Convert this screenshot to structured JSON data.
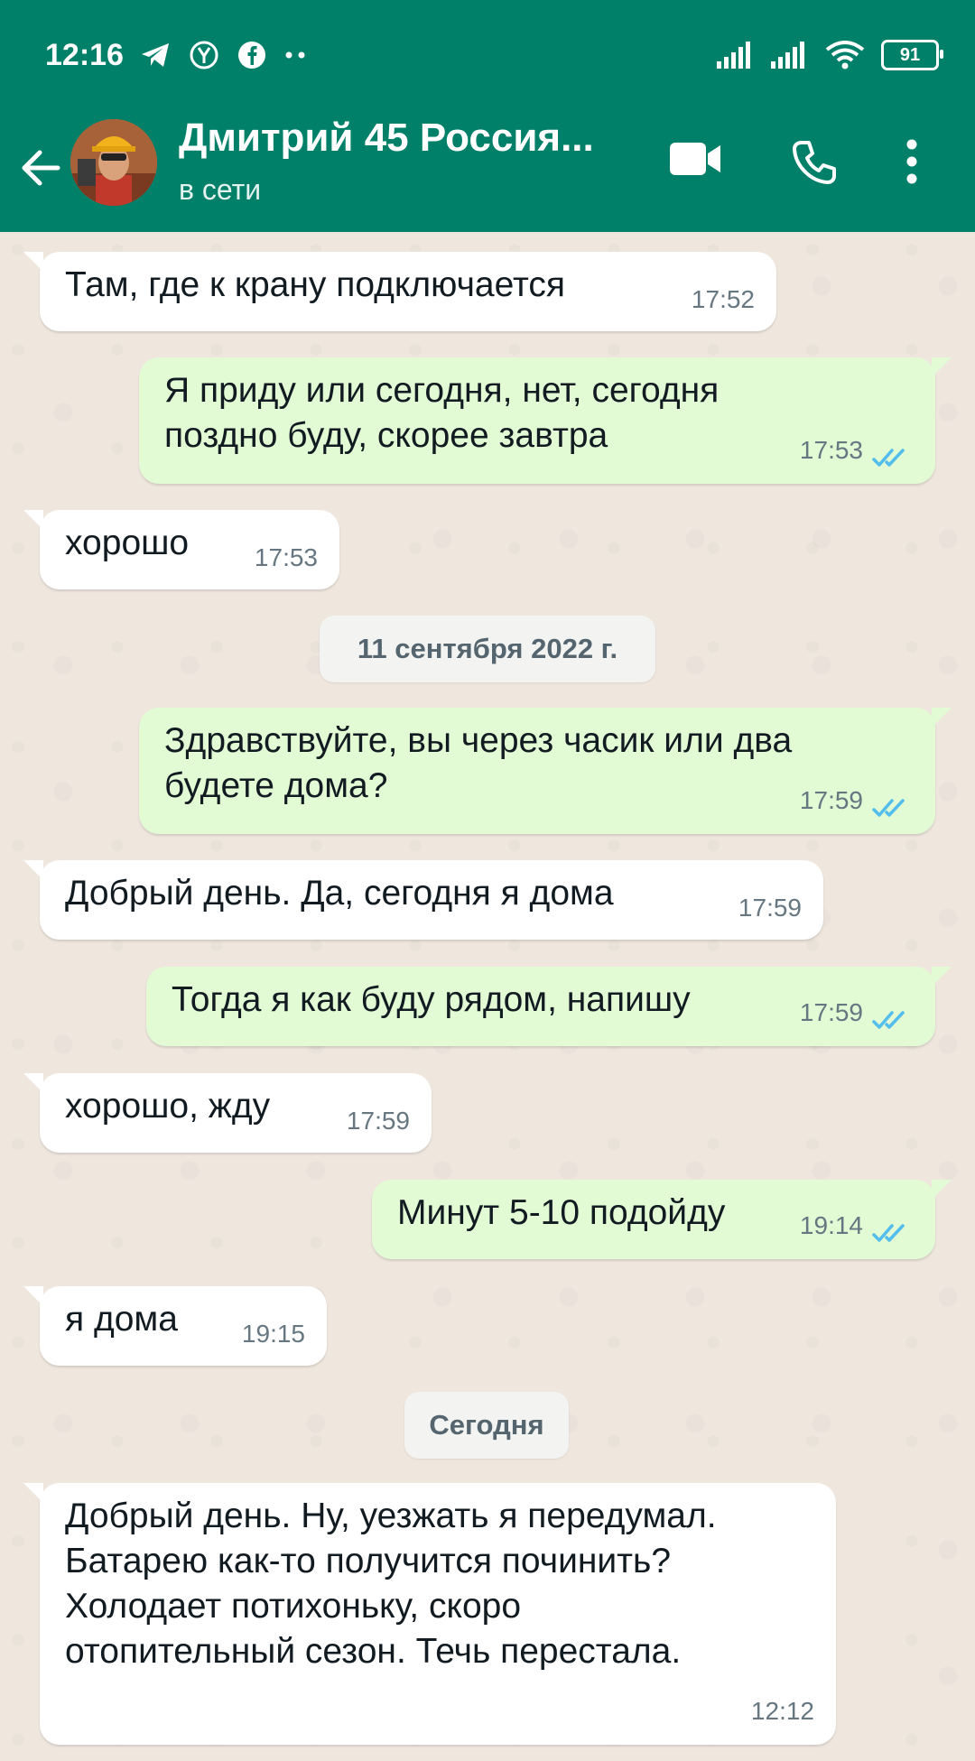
{
  "status_bar": {
    "time": "12:16",
    "battery": "91"
  },
  "header": {
    "contact_name": "Дмитрий 45 Россия...",
    "contact_status": "в сети",
    "accent_color": "#008069"
  },
  "messages": [
    {
      "dir": "in",
      "text": "Там, где к крану подключается",
      "time": "17:52"
    },
    {
      "dir": "out",
      "text": "Я приду или сегодня, нет, сегодня\nпоздно буду, скорее завтра",
      "time": "17:53",
      "read": true
    },
    {
      "dir": "in",
      "text": "хорошо",
      "time": "17:53"
    },
    {
      "dir": "date",
      "text": "11 сентября 2022 г."
    },
    {
      "dir": "out",
      "text": "Здравствуйте, вы через часик или два\nбудете дома?",
      "time": "17:59",
      "read": true
    },
    {
      "dir": "in",
      "text": "Добрый день. Да, сегодня я дома",
      "time": "17:59"
    },
    {
      "dir": "out",
      "text": "Тогда я как буду рядом, напишу",
      "time": "17:59",
      "read": true
    },
    {
      "dir": "in",
      "text": "хорошо, жду",
      "time": "17:59"
    },
    {
      "dir": "out",
      "text": "Минут 5-10 подойду",
      "time": "19:14",
      "read": true
    },
    {
      "dir": "in",
      "text": "я дома",
      "time": "19:15"
    },
    {
      "dir": "date",
      "text": "Сегодня"
    },
    {
      "dir": "in",
      "text": "Добрый день. Ну, уезжать я передумал.\nБатарею как-то получится починить?\nХолодает потихоньку, скоро\nотопительный сезон. Течь перестала.",
      "time": "12:12"
    }
  ]
}
